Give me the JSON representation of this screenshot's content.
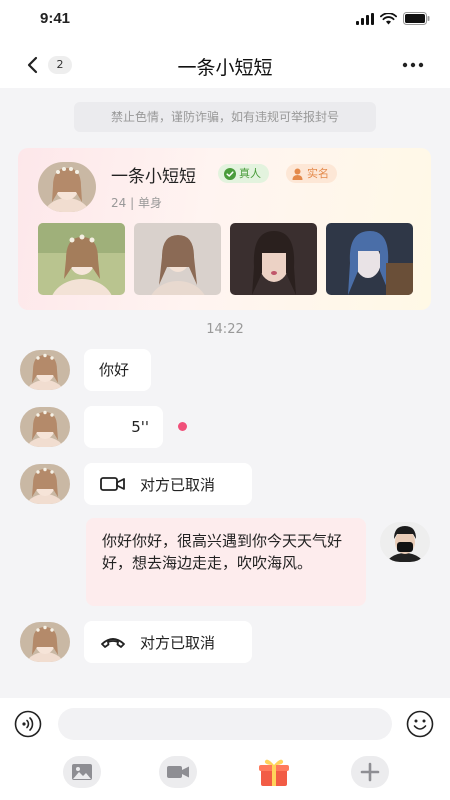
{
  "status_bar": {
    "time": "9:41"
  },
  "header": {
    "unread_count": "2",
    "title": "一条小短短"
  },
  "notice": "禁止色情，谨防诈骗，如有违规可举报封号",
  "profile": {
    "name": "一条小短短",
    "tag_real": "真人",
    "tag_verified": "实名",
    "meta": "24 | 单身",
    "photo_count": 4
  },
  "chat": {
    "timestamp": "14:22",
    "messages": [
      {
        "from": "them",
        "type": "text",
        "text": "你好"
      },
      {
        "from": "them",
        "type": "voice",
        "duration": "5''",
        "unread": true
      },
      {
        "from": "them",
        "type": "video_call",
        "text": "对方已取消"
      },
      {
        "from": "me",
        "type": "text",
        "text": "你好你好，很高兴遇到你今天天气好好，想去海边走走，吹吹海风。"
      },
      {
        "from": "them",
        "type": "voice_call",
        "text": "对方已取消"
      }
    ]
  },
  "composer": {
    "input_value": "",
    "tools": [
      "image-icon",
      "video-icon",
      "gift-icon",
      "plus-icon"
    ]
  },
  "colors": {
    "my_bubble": "#fdeced",
    "their_bubble": "#ffffff",
    "unread_dot": "#f0507a",
    "tag_real": "#4a9c3b",
    "tag_verified": "#e48a4b"
  }
}
